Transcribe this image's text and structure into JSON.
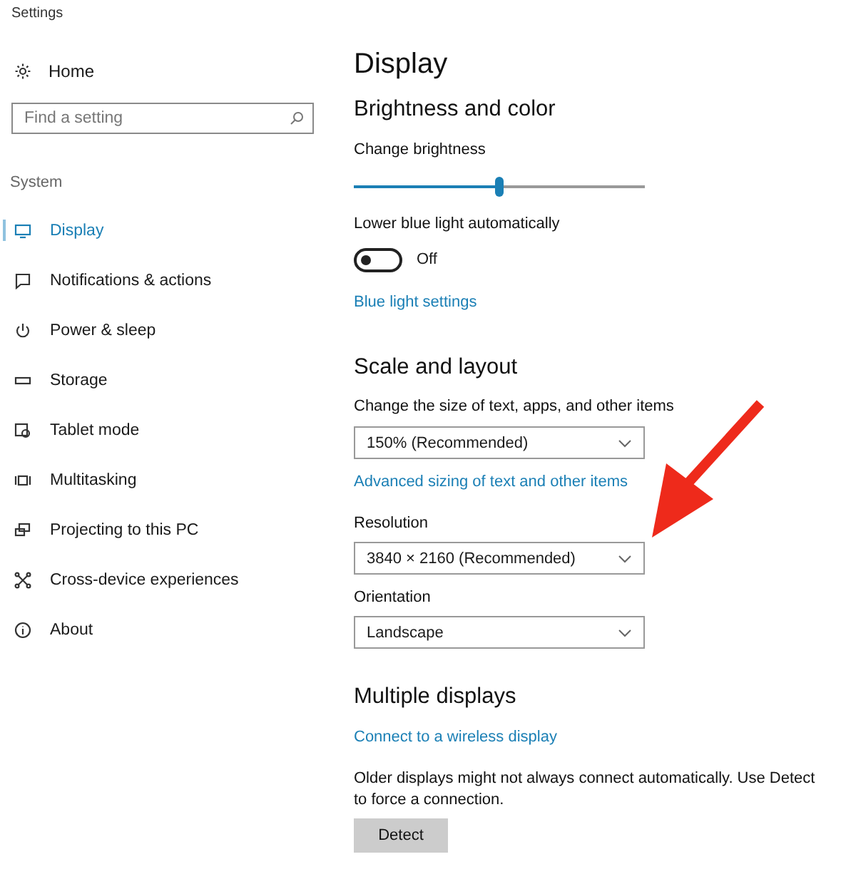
{
  "window": {
    "title": "Settings"
  },
  "sidebar": {
    "home": "Home",
    "search": {
      "placeholder": "Find a setting"
    },
    "group": "System",
    "items": [
      {
        "label": "Display",
        "selected": true
      },
      {
        "label": "Notifications & actions",
        "selected": false
      },
      {
        "label": "Power & sleep",
        "selected": false
      },
      {
        "label": "Storage",
        "selected": false
      },
      {
        "label": "Tablet mode",
        "selected": false
      },
      {
        "label": "Multitasking",
        "selected": false
      },
      {
        "label": "Projecting to this PC",
        "selected": false
      },
      {
        "label": "Cross-device experiences",
        "selected": false
      },
      {
        "label": "About",
        "selected": false
      }
    ]
  },
  "page": {
    "title": "Display",
    "brightness": {
      "heading": "Brightness and color",
      "slider_label": "Change brightness",
      "level": 0.5,
      "toggle_label": "Lower blue light automatically",
      "on": false,
      "toggle_text": "Off",
      "link": "Blue light settings"
    },
    "scale": {
      "heading": "Scale and layout",
      "size_label": "Change the size of text, apps, and other items",
      "size_value": "150% (Recommended)",
      "link": "Advanced sizing of text and other items",
      "resolution_label": "Resolution",
      "resolution_value": "3840 × 2160 (Recommended)",
      "orientation_label": "Orientation",
      "orientation_value": "Landscape"
    },
    "multiple": {
      "heading": "Multiple displays",
      "link": "Connect to a wireless display",
      "note": "Older displays might not always connect automatically. Use Detect to force a connection.",
      "button": "Detect"
    }
  }
}
